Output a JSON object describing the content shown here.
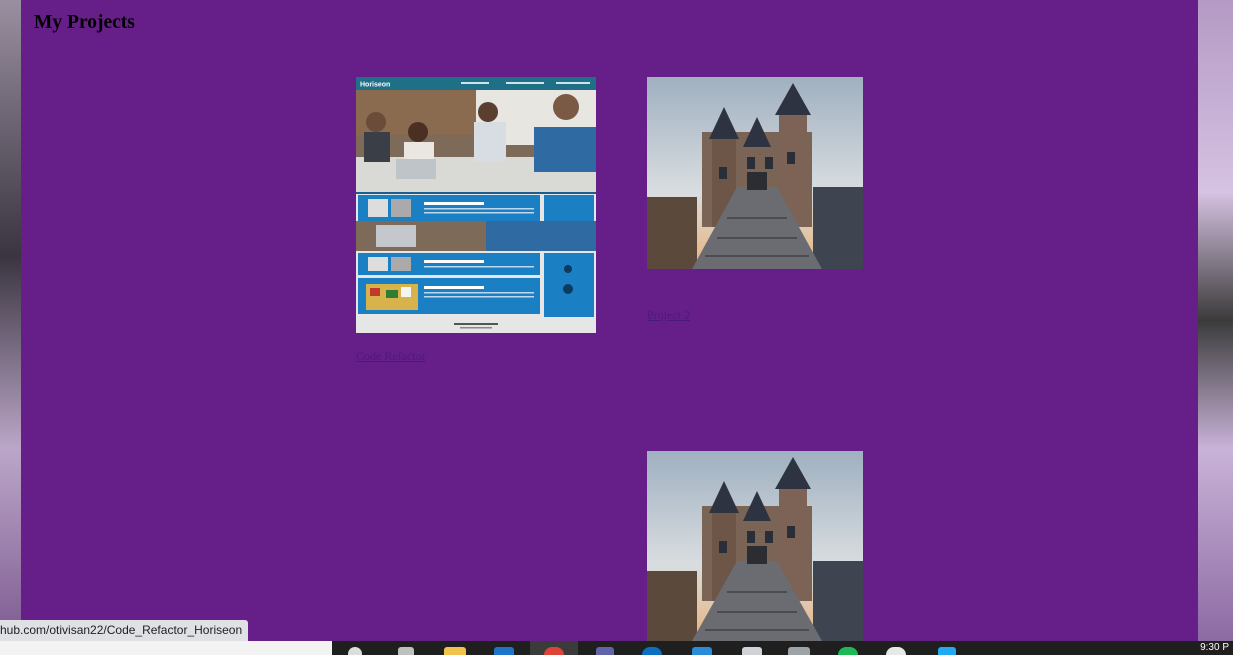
{
  "page": {
    "title": "My Projects"
  },
  "projects": [
    {
      "link_text": "Code Refactor",
      "image": "horiseon-website-screenshot",
      "site_logo": "Horiseon"
    },
    {
      "link_text": "Project 2",
      "image": "castle-stairs-photo"
    },
    {
      "link_text": "",
      "image": "castle-stairs-photo"
    }
  ],
  "status_bar": {
    "url": "hub.com/otivisan22/Code_Refactor_Horiseon"
  },
  "taskbar": {
    "clock": "9:30 P"
  },
  "colors": {
    "page_background": "#661e88",
    "horiseon_blue": "#1b7fc4",
    "horiseon_header": "#1f6f86"
  }
}
